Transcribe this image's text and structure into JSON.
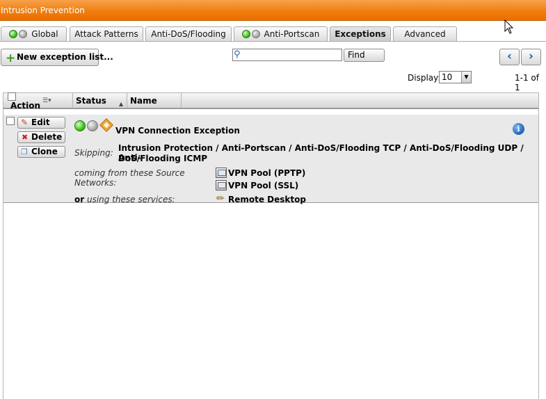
{
  "window": {
    "title": "Intrusion Prevention"
  },
  "tabs": [
    {
      "label": "Global",
      "leds": [
        "green",
        "grey"
      ]
    },
    {
      "label": "Attack Patterns"
    },
    {
      "label": "Anti-DoS/Flooding"
    },
    {
      "label": "Anti-Portscan",
      "leds": [
        "green",
        "grey"
      ]
    },
    {
      "label": "Exceptions",
      "active": true
    },
    {
      "label": "Advanced"
    }
  ],
  "toolbar": {
    "new_label": "New exception list...",
    "search_placeholder": "",
    "find_label": "Find",
    "prev_icon": "chevron-left-icon",
    "next_icon": "chevron-right-icon",
    "display_label": "Display:",
    "display_value": "10",
    "count_text": "1-1 of 1"
  },
  "grid": {
    "columns": {
      "action": "Action",
      "status": "Status",
      "name": "Name"
    },
    "rows": [
      {
        "buttons": {
          "edit": "Edit",
          "delete": "Delete",
          "clone": "Clone"
        },
        "status_leds": [
          "green",
          "grey"
        ],
        "name": "VPN Connection Exception",
        "skipping_label": "Skipping:",
        "skipping_line1": "Intrusion Protection / Anti-Portscan / Anti-DoS/Flooding TCP / Anti-DoS/Flooding UDP / Anti-",
        "skipping_line2": "DoS/Flooding ICMP",
        "source_label_1": "coming from these Source",
        "source_label_2": "Networks:",
        "networks": [
          "VPN Pool (PPTP)",
          "VPN Pool (SSL)"
        ],
        "services_or": "or",
        "services_label": " using these services:",
        "services": [
          "Remote Desktop"
        ]
      }
    ]
  },
  "colors": {
    "titlebar": "#ef7f10",
    "led_green": "#3ec11b",
    "led_grey": "#a9a9a9",
    "row_bg": "#e9e9e9",
    "nav_arrow": "#1f5fb0"
  }
}
